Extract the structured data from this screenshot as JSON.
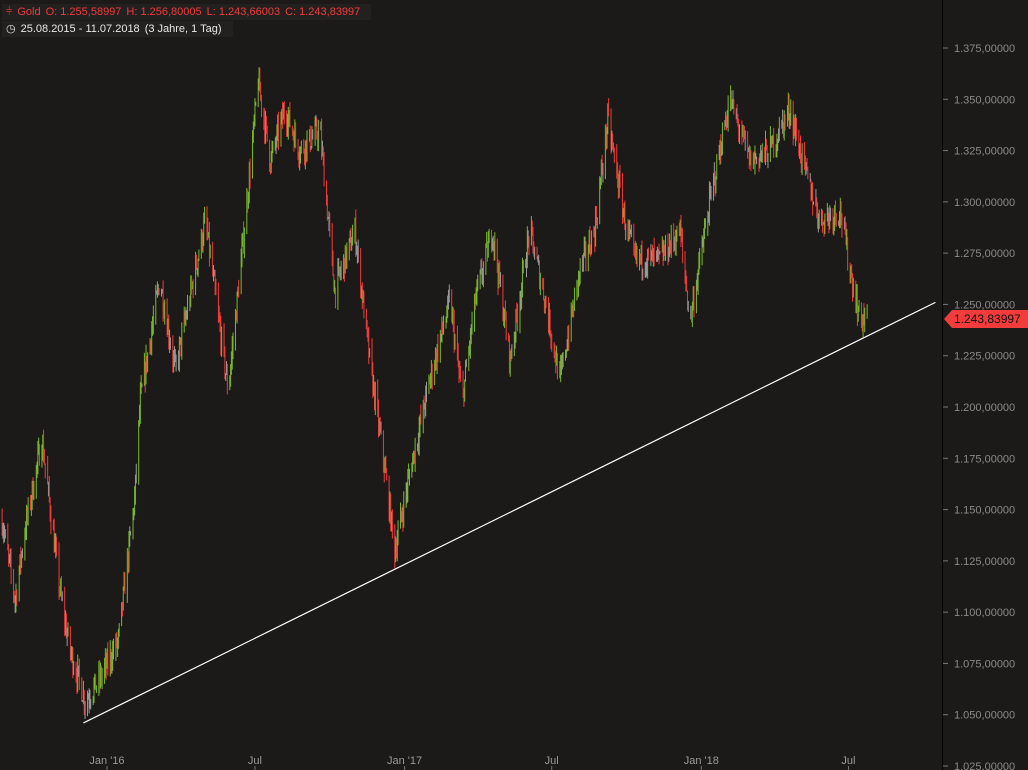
{
  "header": {
    "symbol": "Gold",
    "open": "O: 1.255,58997",
    "high": "H: 1.256,80005",
    "low": "L: 1.243,66003",
    "close": "C: 1.243,83997",
    "range": "25.08.2015 - 11.07.2018",
    "duration": "(3 Jahre, 1 Tag)"
  },
  "last_price": "1.243,83997",
  "colors": {
    "up": "#7ab92a",
    "down": "#f23b3b",
    "neutral": "#9a9a9a",
    "trendline": "#ffffff",
    "background": "#1b1a19"
  },
  "chart_data": {
    "type": "candlestick",
    "title": "Gold",
    "x_unit": "days since 25.08.2015",
    "ylim": [
      1.025,
      1.375
    ],
    "y_ticks": [
      "1.375,00000",
      "1.350,00000",
      "1.325,00000",
      "1.300,00000",
      "1.275,00000",
      "1.250,00000",
      "1.225,00000",
      "1.200,00000",
      "1.175,00000",
      "1.150,00000",
      "1.125,00000",
      "1.100,00000",
      "1.075,00000",
      "1.050,00000",
      "1.025,00000"
    ],
    "x_ticks": [
      {
        "label": "Jan '16",
        "day": 129
      },
      {
        "label": "Jul",
        "day": 311
      },
      {
        "label": "Jan '17",
        "day": 495
      },
      {
        "label": "Jul",
        "day": 676
      },
      {
        "label": "Jan '18",
        "day": 860
      },
      {
        "label": "Jul",
        "day": 1041
      }
    ],
    "approx_close": [
      [
        0,
        1.145
      ],
      [
        16,
        1.106
      ],
      [
        28,
        1.14
      ],
      [
        49,
        1.184
      ],
      [
        71,
        1.111
      ],
      [
        83,
        1.082
      ],
      [
        102,
        1.057
      ],
      [
        120,
        1.067
      ],
      [
        143,
        1.086
      ],
      [
        163,
        1.155
      ],
      [
        170,
        1.203
      ],
      [
        194,
        1.262
      ],
      [
        213,
        1.218
      ],
      [
        250,
        1.291
      ],
      [
        278,
        1.208
      ],
      [
        299,
        1.291
      ],
      [
        315,
        1.359
      ],
      [
        330,
        1.32
      ],
      [
        348,
        1.345
      ],
      [
        366,
        1.325
      ],
      [
        391,
        1.335
      ],
      [
        409,
        1.257
      ],
      [
        434,
        1.286
      ],
      [
        452,
        1.223
      ],
      [
        471,
        1.169
      ],
      [
        483,
        1.13
      ],
      [
        502,
        1.169
      ],
      [
        526,
        1.213
      ],
      [
        551,
        1.252
      ],
      [
        566,
        1.203
      ],
      [
        582,
        1.252
      ],
      [
        603,
        1.286
      ],
      [
        625,
        1.223
      ],
      [
        649,
        1.286
      ],
      [
        668,
        1.252
      ],
      [
        686,
        1.213
      ],
      [
        711,
        1.267
      ],
      [
        729,
        1.286
      ],
      [
        745,
        1.34
      ],
      [
        766,
        1.291
      ],
      [
        778,
        1.272
      ],
      [
        809,
        1.272
      ],
      [
        834,
        1.286
      ],
      [
        846,
        1.242
      ],
      [
        871,
        1.301
      ],
      [
        895,
        1.35
      ],
      [
        920,
        1.32
      ],
      [
        944,
        1.325
      ],
      [
        969,
        1.345
      ],
      [
        987,
        1.316
      ],
      [
        1006,
        1.291
      ],
      [
        1031,
        1.296
      ],
      [
        1043,
        1.267
      ],
      [
        1055,
        1.243
      ],
      [
        1064,
        1.2438
      ]
    ],
    "trendline": [
      [
        100,
        1.046
      ],
      [
        1148,
        1.251
      ]
    ]
  }
}
